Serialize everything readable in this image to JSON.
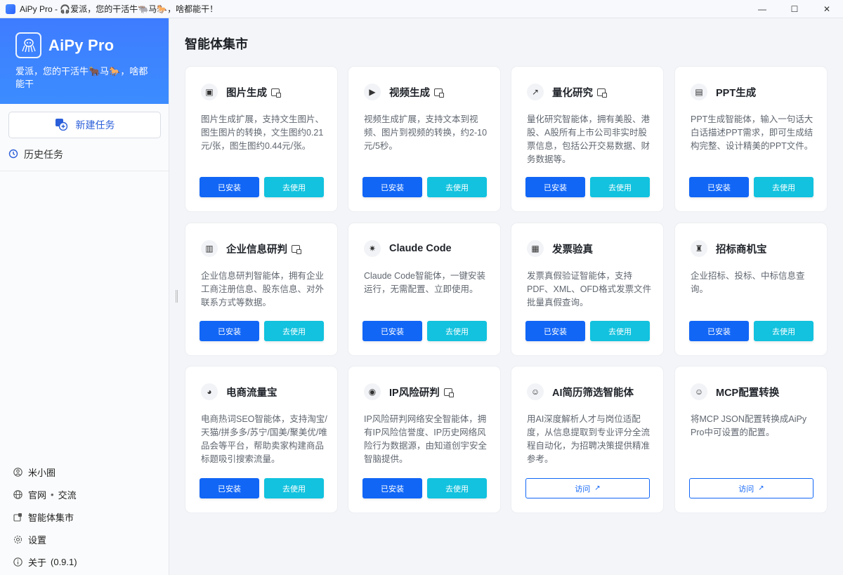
{
  "window": {
    "title": "AiPy Pro - 🎧爱派，您的干活牛🐃马🐎，啥都能干！",
    "controls": [
      "—",
      "☐",
      "✕"
    ]
  },
  "sidebar": {
    "brand_name": "AiPy Pro",
    "slogan": "爱派，您的干活牛🐂马🐎，啥都能干",
    "new_task": "新建任务",
    "history": "历史任务",
    "bottom": {
      "community": "米小圈",
      "website": "官网",
      "dot": "•",
      "exchange": "交流",
      "market": "智能体集市",
      "settings": "设置",
      "about": "关于",
      "version": "(0.9.1)"
    }
  },
  "main": {
    "title": "智能体集市",
    "installed_label": "已安装",
    "use_label": "去使用",
    "visit_label": "访问",
    "cards": [
      {
        "title": "图片生成",
        "icon": "image-icon",
        "desc": "图片生成扩展，支持文生图片、图生图片的转换，文生图约0.21元/张，图生图约0.44元/张。",
        "badge": true,
        "action": "installed"
      },
      {
        "title": "视频生成",
        "icon": "video-icon",
        "desc": "视频生成扩展，支持文本到视频、图片到视频的转换，约2-10元/5秒。",
        "badge": true,
        "action": "installed"
      },
      {
        "title": "量化研究",
        "icon": "chart-icon",
        "desc": "量化研究智能体，拥有美股、港股、A股所有上市公司非实时股票信息，包括公开交易数据、财务数据等。",
        "badge": true,
        "action": "installed"
      },
      {
        "title": "PPT生成",
        "icon": "presentation-icon",
        "desc": "PPT生成智能体，输入一句话大白话描述PPT需求，即可生成结构完整、设计精美的PPT文件。",
        "badge": false,
        "action": "installed"
      },
      {
        "title": "企业信息研判",
        "icon": "enterprise-icon",
        "desc": "企业信息研判智能体，拥有企业工商注册信息、股东信息、对外联系方式等数据。",
        "badge": true,
        "action": "installed"
      },
      {
        "title": "Claude Code",
        "icon": "claude-icon",
        "desc": "Claude Code智能体，一键安装运行，无需配置、立即使用。",
        "badge": false,
        "action": "installed"
      },
      {
        "title": "发票验真",
        "icon": "invoice-icon",
        "desc": "发票真假验证智能体，支持PDF、XML、OFD格式发票文件批量真假查询。",
        "badge": false,
        "action": "installed"
      },
      {
        "title": "招标商机宝",
        "icon": "tender-icon",
        "desc": "企业招标、投标、中标信息查询。",
        "badge": false,
        "action": "installed"
      },
      {
        "title": "电商流量宝",
        "icon": "ecommerce-icon",
        "desc": "电商热词SEO智能体，支持淘宝/天猫/拼多多/苏宁/国美/聚美优/唯品会等平台，帮助卖家构建商品标题吸引搜索流量。",
        "badge": false,
        "action": "installed"
      },
      {
        "title": "IP风险研判",
        "icon": "ip-risk-icon",
        "desc": "IP风险研判网络安全智能体，拥有IP风险信誉度、IP历史网络风险行为数据源，由知道创宇安全智脑提供。",
        "badge": true,
        "action": "installed"
      },
      {
        "title": "AI简历筛选智能体",
        "icon": "resume-icon",
        "desc": "用AI深度解析人才与岗位适配度，从信息提取到专业评分全流程自动化，为招聘决策提供精准参考。",
        "badge": false,
        "action": "visit"
      },
      {
        "title": "MCP配置转换",
        "icon": "mcp-config-icon",
        "desc": "将MCP JSON配置转换成AiPy Pro中可设置的配置。",
        "badge": false,
        "action": "visit"
      }
    ]
  },
  "colors": {
    "brand_blue": "#3e7cff",
    "installed_blue": "#1166f6",
    "use_cyan": "#12c2de"
  }
}
